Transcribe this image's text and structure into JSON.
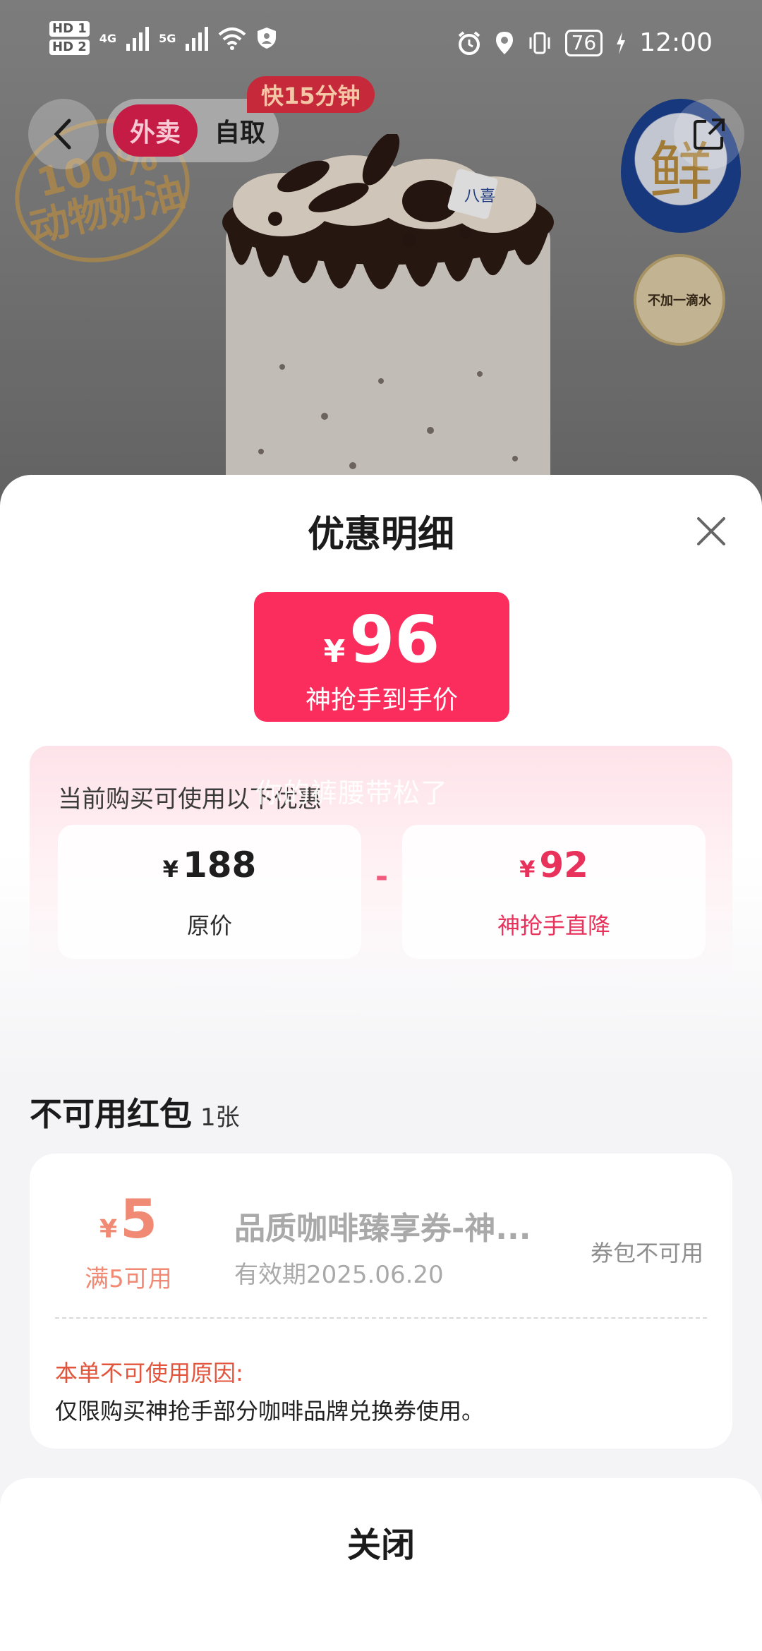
{
  "status_bar": {
    "hd1": "HD 1",
    "hd2": "HD 2",
    "net1": "4G",
    "net2": "5G",
    "battery": "76",
    "time": "12:00"
  },
  "header": {
    "tab_delivery": "外卖",
    "tab_pickup": "自取",
    "fast_badge": "快15分钟"
  },
  "hero": {
    "stamp_text": "100%\n动物奶油",
    "fresh_seal_char": "鲜",
    "water_seal_text": "不加一滴水"
  },
  "sheet": {
    "title": "优惠明细",
    "final_price": {
      "currency": "¥",
      "amount": "96",
      "label": "神抢手到手价"
    },
    "hint": "当前购买可使用以下优惠",
    "watermark": "你的裤腰带松了",
    "original": {
      "currency": "¥",
      "amount": "188",
      "label": "原价"
    },
    "operator": "-",
    "discount": {
      "currency": "¥",
      "amount": "92",
      "label": "神抢手直降"
    },
    "unavailable_section": {
      "title": "不可用红包",
      "count": "1张"
    },
    "coupon": {
      "currency": "¥",
      "amount": "5",
      "condition": "满5可用",
      "name": "品质咖啡臻享券-神...",
      "expiry": "有效期2025.06.20",
      "status": "券包不可用",
      "reason_title": "本单不可使用原因:",
      "reason_text": "仅限购买神抢手部分咖啡品牌兑换券使用。"
    },
    "close_label": "关闭"
  },
  "colors": {
    "accent": "#fb2d5d",
    "discount_text": "#e8325c",
    "coupon_amount": "#f08a74",
    "reason_title": "#e2543b"
  }
}
